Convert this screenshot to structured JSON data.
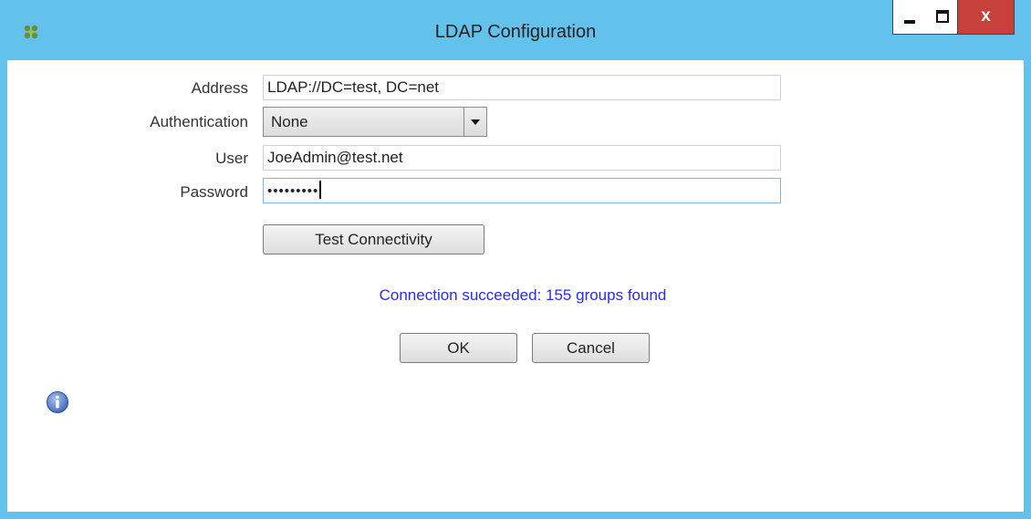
{
  "window": {
    "title": "LDAP Configuration",
    "app_icon": "citrix-app-icon",
    "controls": {
      "minimize": "minimize-icon",
      "maximize": "maximize-icon",
      "close_label": "x"
    }
  },
  "form": {
    "address": {
      "label": "Address",
      "value": "LDAP://DC=test, DC=net"
    },
    "authentication": {
      "label": "Authentication",
      "value": "None"
    },
    "user": {
      "label": "User",
      "value": "JoeAdmin@test.net"
    },
    "password": {
      "label": "Password",
      "value": "•••••••••"
    }
  },
  "buttons": {
    "test": "Test Connectivity",
    "ok": "OK",
    "cancel": "Cancel"
  },
  "status": {
    "message": "Connection succeeded: 155 groups found",
    "color": "#2a2af0"
  },
  "colors": {
    "titlebar": "#63c2ec",
    "close": "#c7413a"
  },
  "footer": {
    "icon": "info-icon"
  }
}
